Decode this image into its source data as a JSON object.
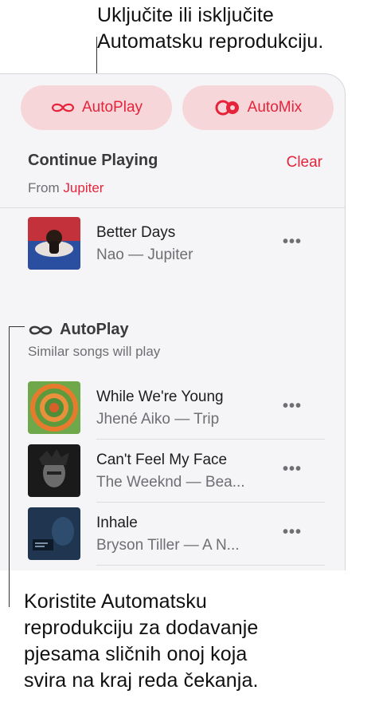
{
  "callouts": {
    "top_line1": "Uključite ili isključite",
    "top_line2": "Automatsku reprodukciju.",
    "bottom_line1": "Koristite Automatsku",
    "bottom_line2": "reprodukciju za dodavanje",
    "bottom_line3": "pjesama sličnih onoj koja",
    "bottom_line4": "svira na kraj reda čekanja."
  },
  "toolbar": {
    "autoplay_label": "AutoPlay",
    "automix_label": "AutoMix",
    "autoplay_icon": "infinity-icon",
    "automix_icon": "automix-icon"
  },
  "continue_playing": {
    "title": "Continue Playing",
    "clear_label": "Clear",
    "from_prefix": "From",
    "from_source": "Jupiter",
    "items": [
      {
        "title": "Better Days",
        "subtitle": "Nao — Jupiter",
        "more_label": "•••"
      }
    ]
  },
  "autoplay_section": {
    "title": "AutoPlay",
    "subtitle": "Similar songs will play",
    "items": [
      {
        "title": "While We're Young",
        "subtitle": "Jhené Aiko — Trip",
        "more_label": "•••"
      },
      {
        "title": "Can't Feel My Face",
        "subtitle": "The Weeknd — Bea...",
        "more_label": "•••"
      },
      {
        "title": "Inhale",
        "subtitle": "Bryson Tiller — A N...",
        "more_label": "•••"
      }
    ]
  },
  "colors": {
    "accent": "#e5243b",
    "pill_background": "#f7d6d9",
    "panel_background": "#f5f5f7"
  }
}
